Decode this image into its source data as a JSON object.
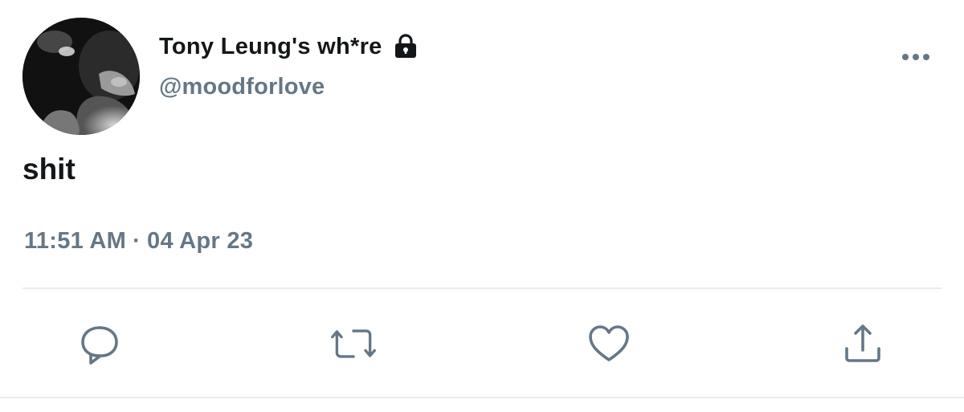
{
  "tweet": {
    "display_name": "Tony Leung's wh*re",
    "handle": "@moodforlove",
    "text": "shit",
    "time": "11:51 AM",
    "separator": "·",
    "date": "04 Apr 23",
    "protected_icon": "lock-icon",
    "avatar": "profile-photo"
  },
  "actions": [
    {
      "name": "reply",
      "icon": "comment-icon"
    },
    {
      "name": "retweet",
      "icon": "retweet-icon"
    },
    {
      "name": "like",
      "icon": "heart-icon"
    },
    {
      "name": "share",
      "icon": "share-icon"
    }
  ],
  "colors": {
    "text_primary": "#14171a",
    "text_secondary": "#657786",
    "divider": "#e6ecf0",
    "icon": "#657786"
  }
}
